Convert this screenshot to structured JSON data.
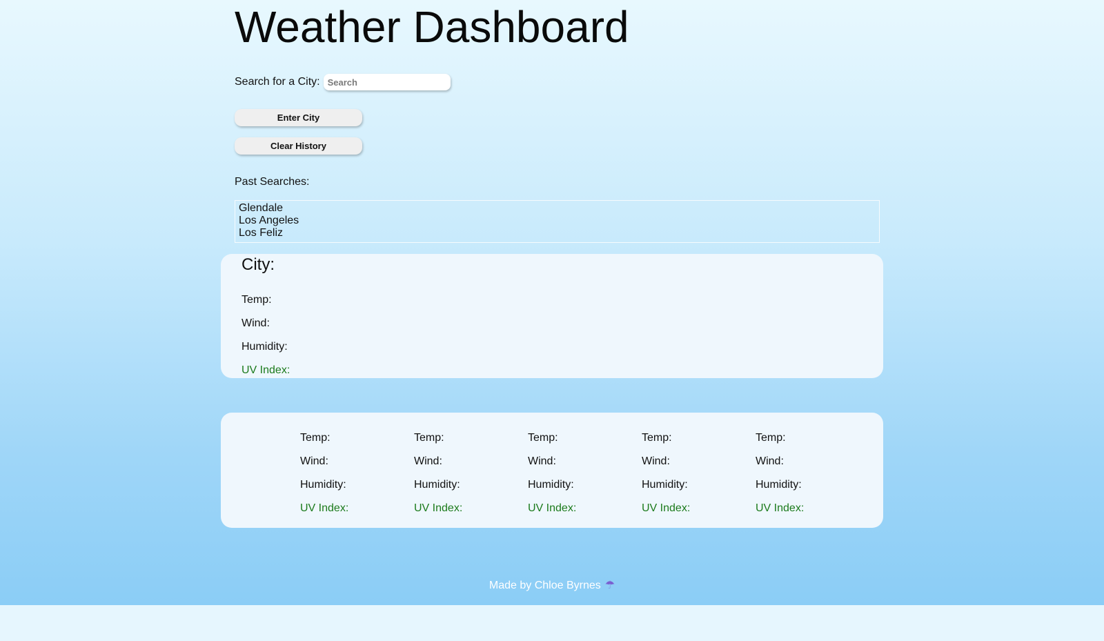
{
  "header": {
    "title": "Weather Dashboard"
  },
  "search": {
    "label": "Search for a City:",
    "placeholder": "Search",
    "enter_button": "Enter City",
    "clear_button": "Clear History"
  },
  "history": {
    "label": "Past Searches:",
    "items": [
      "Glendale",
      "Los Angeles",
      "Los Feliz"
    ]
  },
  "current": {
    "city_label": "City:",
    "temp_label": "Temp:",
    "wind_label": "Wind:",
    "humidity_label": "Humidity:",
    "uv_label": "UV Index:"
  },
  "forecast": [
    {
      "temp_label": "Temp:",
      "wind_label": "Wind:",
      "humidity_label": "Humidity:",
      "uv_label": "UV Index:"
    },
    {
      "temp_label": "Temp:",
      "wind_label": "Wind:",
      "humidity_label": "Humidity:",
      "uv_label": "UV Index:"
    },
    {
      "temp_label": "Temp:",
      "wind_label": "Wind:",
      "humidity_label": "Humidity:",
      "uv_label": "UV Index:"
    },
    {
      "temp_label": "Temp:",
      "wind_label": "Wind:",
      "humidity_label": "Humidity:",
      "uv_label": "UV Index:"
    },
    {
      "temp_label": "Temp:",
      "wind_label": "Wind:",
      "humidity_label": "Humidity:",
      "uv_label": "UV Index:"
    }
  ],
  "footer": {
    "text": "Made by Chloe Byrnes",
    "icon": "umbrella-icon"
  },
  "colors": {
    "uv_green": "#1b7a1b",
    "card_bg": "#eff7fd",
    "sky_bottom": "#8bcdf6"
  }
}
